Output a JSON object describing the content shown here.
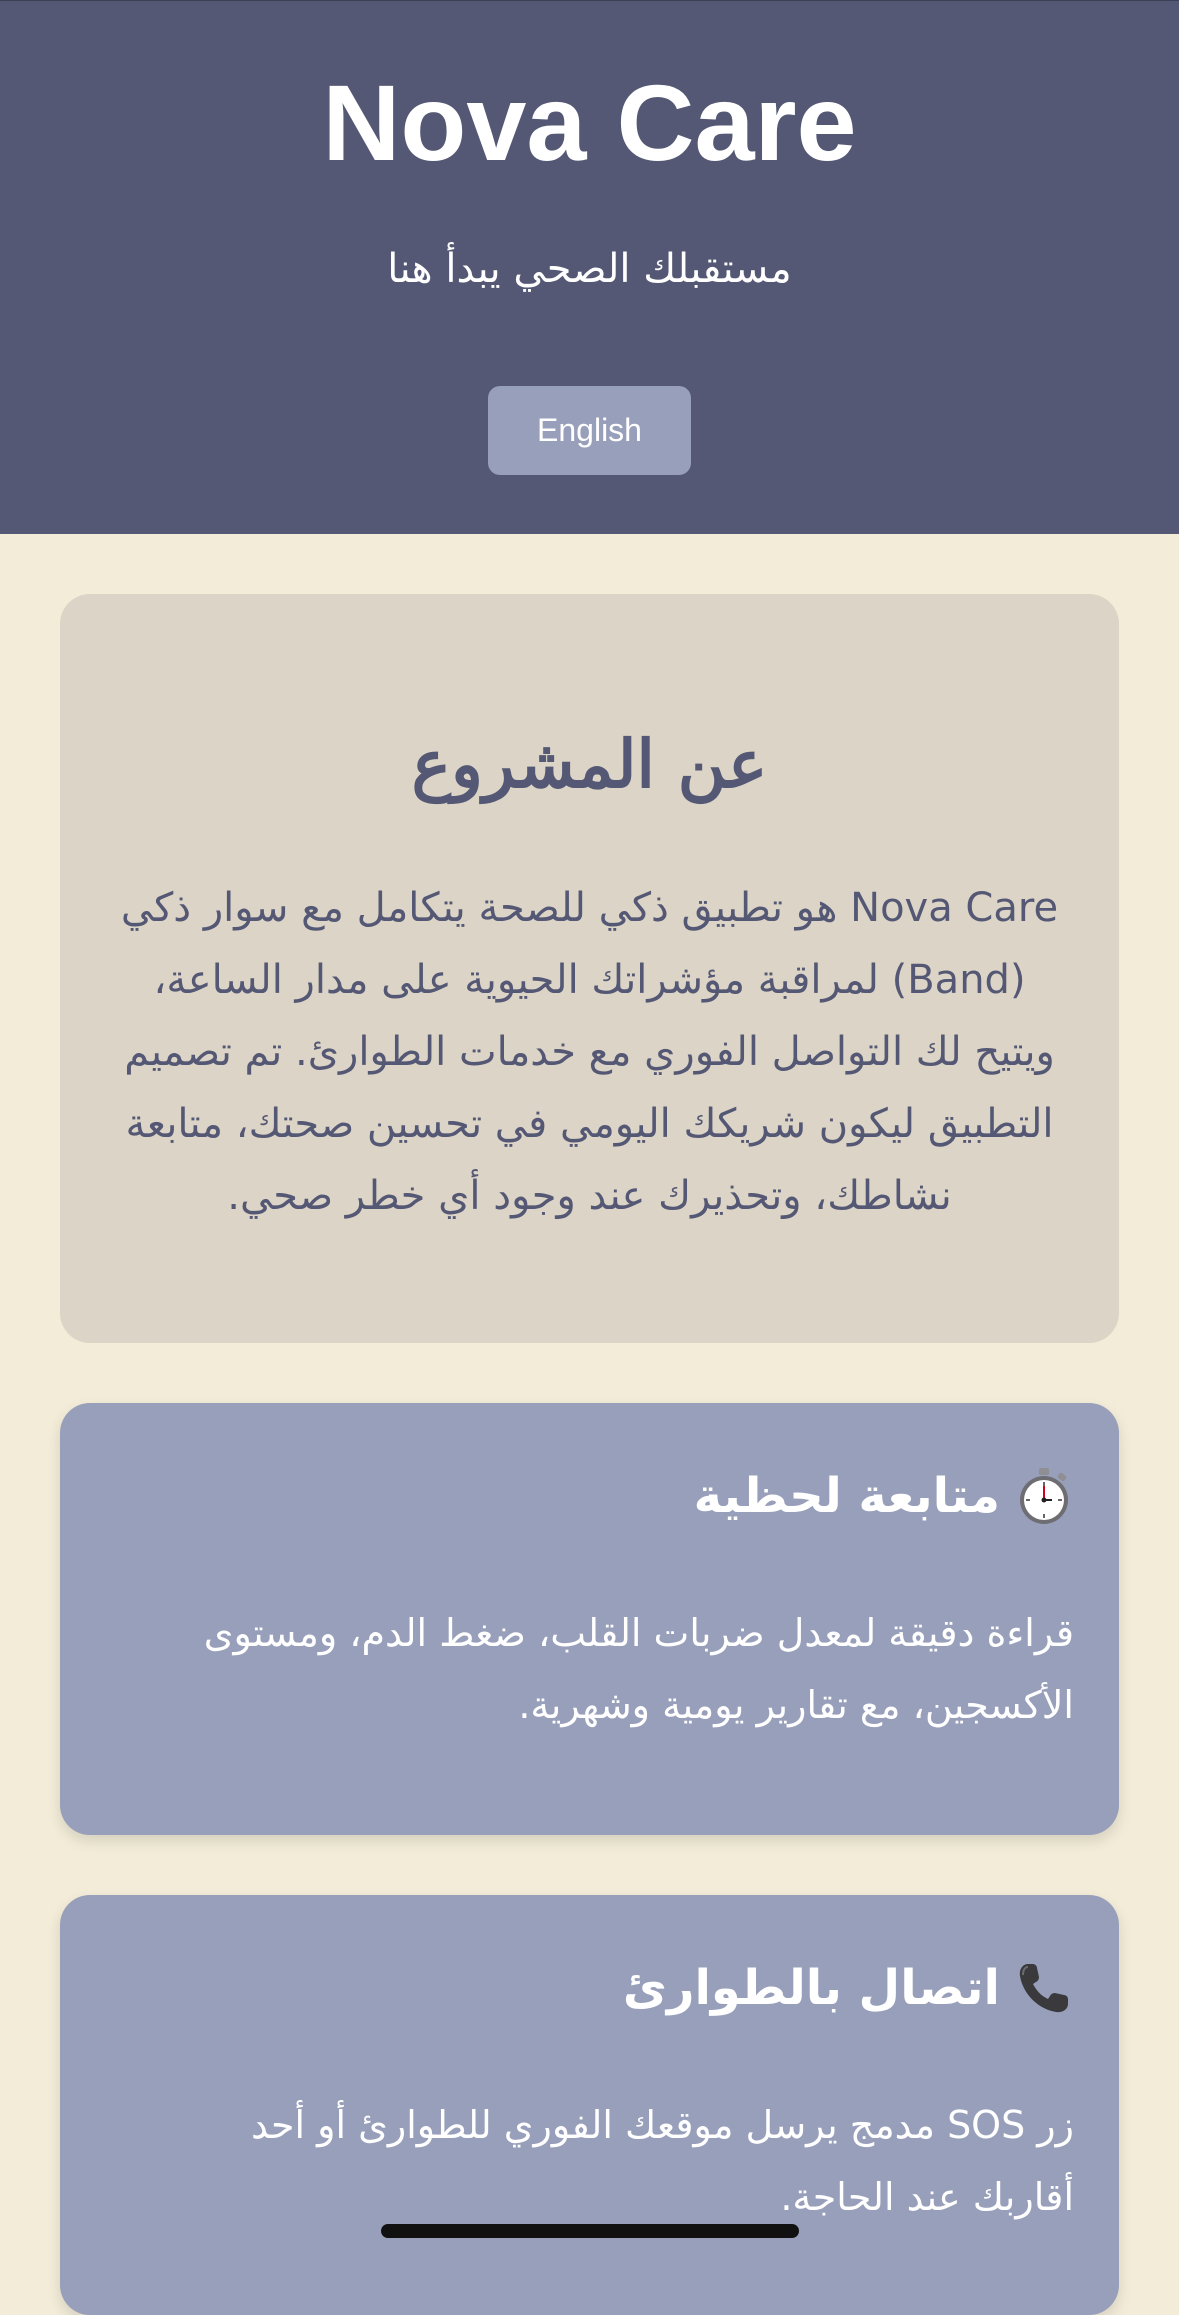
{
  "header": {
    "title": "Nova Care",
    "subtitle": "مستقبلك الصحي يبدأ هنا",
    "language_button": "English"
  },
  "about": {
    "heading": "عن المشروع",
    "text": "Nova Care هو تطبيق ذكي للصحة يتكامل مع سوار ذكي (Band) لمراقبة مؤشراتك الحيوية على مدار الساعة، ويتيح لك التواصل الفوري مع خدمات الطوارئ. تم تصميم التطبيق ليكون شريكك اليومي في تحسين صحتك، متابعة نشاطك، وتحذيرك عند وجود أي خطر صحي."
  },
  "features": [
    {
      "icon": "stopwatch-icon",
      "title": "متابعة لحظية",
      "text": "قراءة دقيقة لمعدل ضربات القلب، ضغط الدم، ومستوى الأكسجين، مع تقارير يومية وشهرية."
    },
    {
      "icon": "phone-icon",
      "title": "اتصال بالطوارئ",
      "text": "زر SOS مدمج يرسل موقعك الفوري للطوارئ أو أحد أقاربك عند الحاجة."
    }
  ],
  "colors": {
    "header_bg": "#545874",
    "page_bg": "#f2ecd8",
    "about_card_bg": "#dcd4c6",
    "feature_card_bg": "#989fba",
    "button_bg": "#989fba",
    "heading_text": "#545874"
  }
}
